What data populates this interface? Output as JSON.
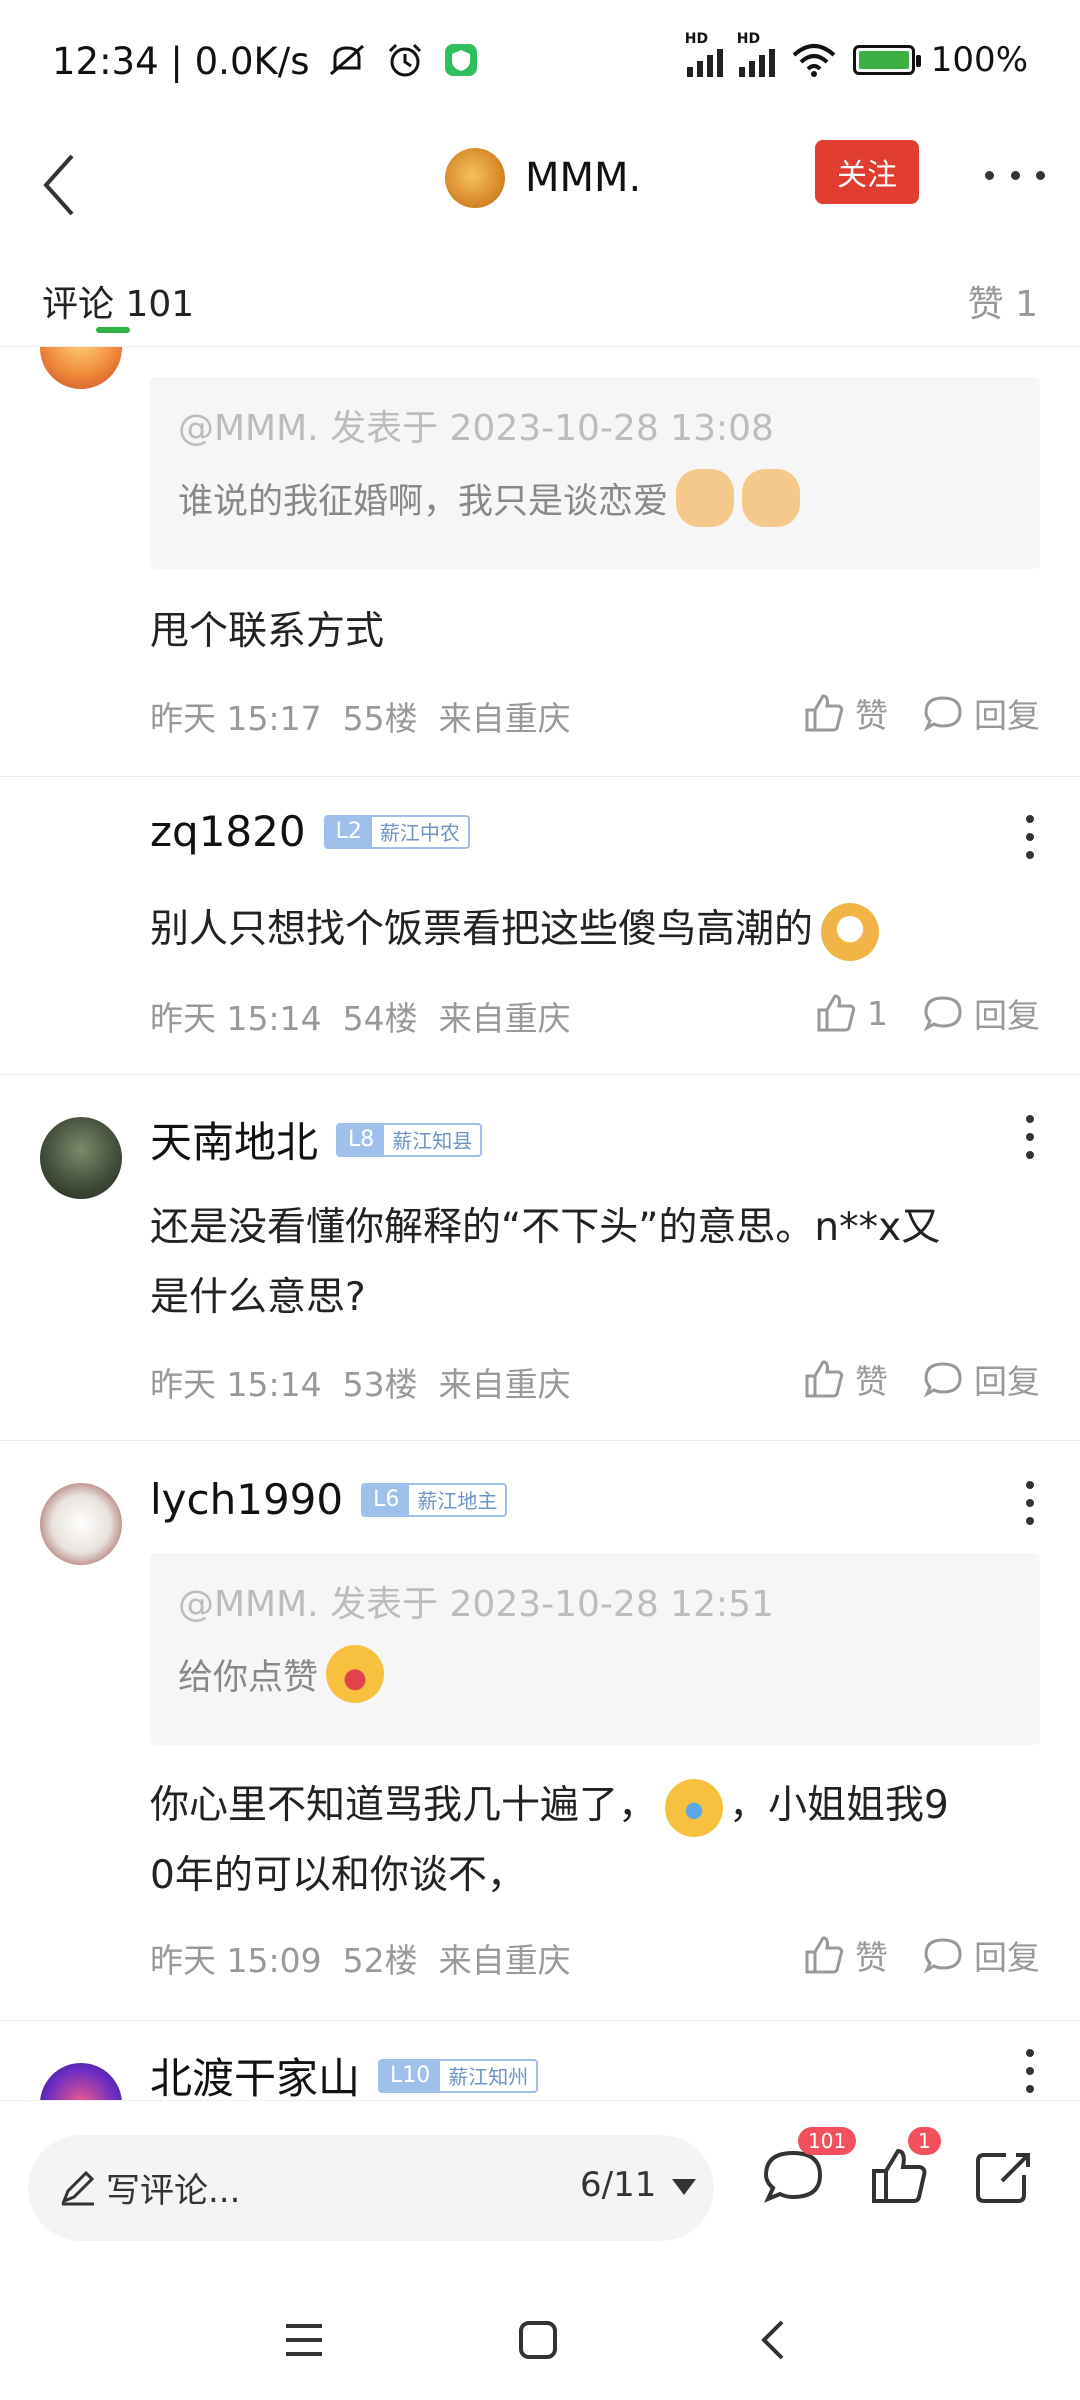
{
  "status_bar": {
    "time": "12:34",
    "speed": "0.0K/s",
    "hd1": "HD",
    "hd2": "HD",
    "battery": "100%"
  },
  "header": {
    "title": "MMM.",
    "follow_label": "关注"
  },
  "tabs": {
    "comments_label": "评论",
    "comments_count": "101",
    "likes_label": "赞 1"
  },
  "comments": [
    {
      "quote_head": "@MMM. 发表于 2023-10-28 13:08",
      "quote_text": "谁说的我征婚啊，我只是谈恋爱",
      "text": "甩个联系方式",
      "time": "昨天 15:17",
      "floor": "55楼",
      "location": "来自重庆",
      "like_label": "赞",
      "reply_label": "回复"
    },
    {
      "username": "zq1820",
      "level": "L2",
      "rank": "薪江中农",
      "text": "别人只想找个饭票看把这些傻鸟高潮的",
      "time": "昨天 15:14",
      "floor": "54楼",
      "location": "来自重庆",
      "like_label": "1",
      "reply_label": "回复"
    },
    {
      "username": "天南地北",
      "level": "L8",
      "rank": "薪江知县",
      "text_line1": "还是没看懂你解释的“不下头”的意思。n**x又",
      "text_line2": "是什么意思?",
      "time": "昨天 15:14",
      "floor": "53楼",
      "location": "来自重庆",
      "like_label": "赞",
      "reply_label": "回复"
    },
    {
      "username": "lych1990",
      "level": "L6",
      "rank": "薪江地主",
      "quote_head": "@MMM. 发表于 2023-10-28 12:51",
      "quote_text": "给你点赞",
      "text_part1": "你心里不知道骂我几十遍了，",
      "text_part2": "，小姐姐我9",
      "text_line2": "0年的可以和你谈不，",
      "time": "昨天 15:09",
      "floor": "52楼",
      "location": "来自重庆",
      "like_label": "赞",
      "reply_label": "回复"
    },
    {
      "username": "北渡干家山",
      "level": "L10",
      "rank": "薪江知州"
    }
  ],
  "bottom_bar": {
    "placeholder": "写评论...",
    "page": "6/11",
    "comment_badge": "101",
    "like_badge": "1"
  },
  "colors": {
    "follow_button": "#e03c2f",
    "tab_underline": "#2fb344",
    "badge": "#f2505d",
    "level_badge": "#9fc0ea"
  }
}
